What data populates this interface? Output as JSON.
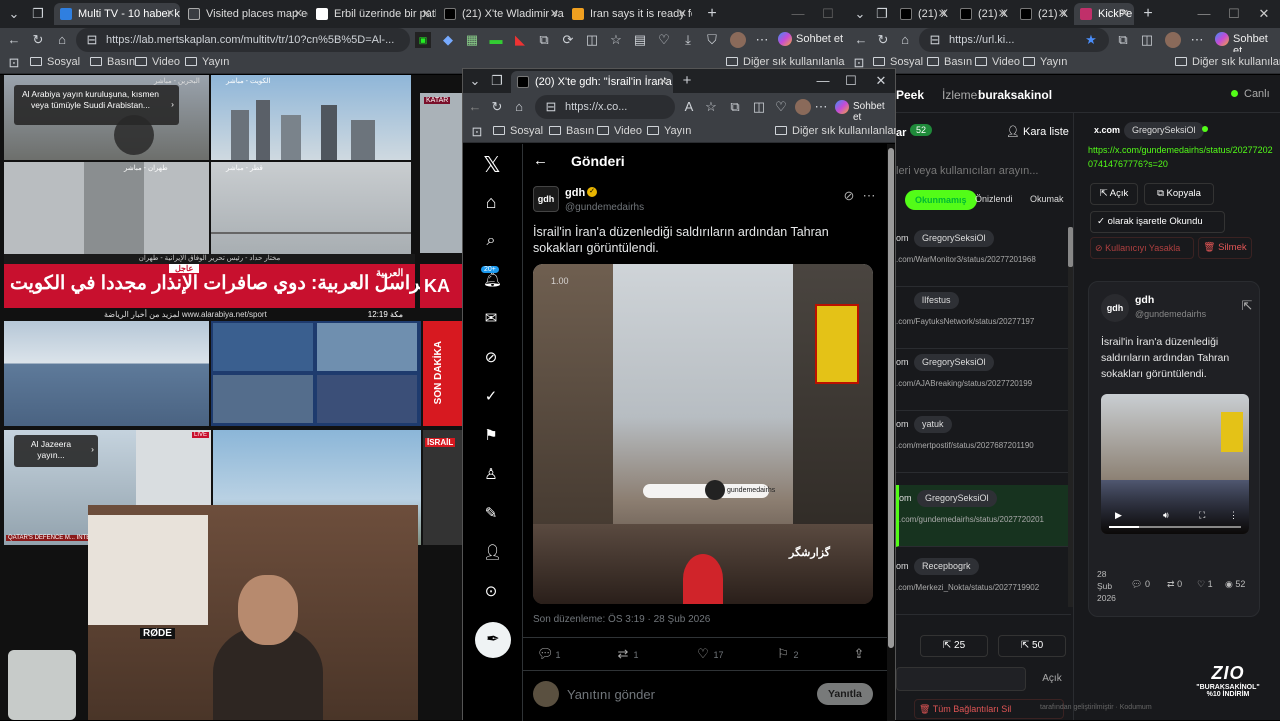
{
  "main_tabs": [
    {
      "label": "Multi TV - 10 haber k",
      "active": true
    },
    {
      "label": "Visited places map editor",
      "active": false
    },
    {
      "label": "Erbil üzerinde bir patlama",
      "active": false
    },
    {
      "label": "(21) X'te Wladimir van W",
      "active": false
    },
    {
      "label": "Iran says it is ready for wa",
      "active": false
    }
  ],
  "right_tabs": [
    {
      "label": "(21) X"
    },
    {
      "label": "(21) X"
    },
    {
      "label": "(21) X"
    },
    {
      "label": "KickPe"
    }
  ],
  "main_address": "https://lab.mertskaplan.com/multitv/tr/10?cn%5B%5D=Al-...",
  "right_address": "https://url.ki...",
  "sohbet_label": "Sohbet et",
  "bookmarks": [
    "Sosyal",
    "Basın",
    "Video",
    "Yayın"
  ],
  "bookmarks_other": "Diğer sık kullanılanlar",
  "tv": {
    "alarabiya_overlay": "Al Arabiya yayın kuruluşuna, kısmen veya tümüyle Suudi Arabistan...",
    "aljazeera_overlay": "Al Jazeera yayın...",
    "alarabiya_urgent": "عاجل",
    "alarabiya_headline": "مراسل العربية: دوي صافرات الإنذار مجددا في الكويت",
    "alarabiya_sub": "لمزيد من أخبار الرياضة www.alarabiya.net/sport",
    "alarabiya_time": "12:19 مكة",
    "alarabiya_logo": "العربية",
    "son_dakika": "SON DAKİKA",
    "israil": "İSRAİL",
    "katar": "KATAR",
    "kuwait_label": "KA",
    "tehran_caption": "مختار حداد - رئيس تحرير الوفاق الإيرانية - طهران",
    "cam_labels": [
      "الكويت - مباشر",
      "البحرين - مباشر",
      "طهران - مباشر",
      "قطر - مباشر"
    ],
    "qatar_defence": "QATAR'S DEFENCE M... INTERCEPTED A N...",
    "live_badge": "LIVE",
    "rode_label": "RØDE"
  },
  "popup": {
    "tab_title": "(20) X'te gdh: \"İsrail'in İran'a d",
    "address": "https://x.co...",
    "sohbet": "Sohbet et",
    "bookmarks": [
      "Sosyal",
      "Basın",
      "Video",
      "Yayın"
    ],
    "bookmarks_other": "Diğer sık kullanılanlar",
    "x_logo": "𝕏",
    "notif_count": "20+",
    "header_title": "Gönderi",
    "author_name": "gdh",
    "author_handle": "@gundemedairhs",
    "avatar_text": "gdh",
    "post_text": "İsrail'in İran'a düzenlediği saldırıların ardından Tahran sokakları görüntülendi.",
    "video_timecode": "1.00",
    "video_watermark": "gundemedairhs",
    "video_overlay_text": "گزارشگر",
    "edited_line": "Son düzenleme: ÖS 3:19 · 28 Şub 2026",
    "replies": "1",
    "reposts": "1",
    "likes": "17",
    "bookmarks_count": "2",
    "reply_placeholder": "Yanıtını gönder",
    "reply_button": "Yanıtla"
  },
  "kick": {
    "brand": "Peek",
    "watching_label": "İzleme:",
    "watching_user": "buraksakinol",
    "live_label": "Canlı",
    "list_tab": "ar",
    "count_badge": "52",
    "blacklist": "Kara liste",
    "search_placeholder": "leri veya kullanıcıları arayın...",
    "filters": [
      "Okunmamış",
      "Önizlendi",
      "Okumak"
    ],
    "rows": [
      {
        "prefix": "om",
        "user": "GregorySeksiOl",
        "link": ".com/WarMonitor3/status/20277201968"
      },
      {
        "prefix": "",
        "user": "lIfestus",
        "link": ".com/FaytuksNetwork/status/20277197"
      },
      {
        "prefix": "om",
        "user": "GregorySeksiOl",
        "link": ".com/AJABreaking/status/2027720199"
      },
      {
        "prefix": "om",
        "user": "yatuk",
        "link": ".com/mertpostif/status/2027687201190"
      },
      {
        "prefix": "om",
        "user": "GregorySeksiOl",
        "link": ".com/gundemedairhs/status/2027720201"
      },
      {
        "prefix": "om",
        "user": "Recepbogrk",
        "link": ".com/Merkezi_Nokta/status/2027719902"
      }
    ],
    "btn_25": "25",
    "btn_50": "50",
    "open_btn": "Açık",
    "delete_all": "Tüm Bağlantıları Sil",
    "source_site": "x.com",
    "source_user": "GregorySeksiOl",
    "detail_link": "https://x.com/gundemedairhs/status/2027720207414767776?s=20",
    "action_open": "Açık",
    "action_copy": "Kopyala",
    "mark_read": "olarak işaretle Okundu",
    "ban_user": "Kullanıcıyı Yasakla",
    "delete": "Silmek",
    "card_name": "gdh",
    "card_handle": "@gundemedairhs",
    "card_avatar": "gdh",
    "card_text": "İsrail'in İran'a düzenlediği saldırıların ardından Tahran sokakları görüntülendi.",
    "card_date_day": "28",
    "card_date_month": "Şub",
    "card_date_year": "2026",
    "card_replies": "0",
    "card_reposts": "0",
    "card_likes": "1",
    "card_views": "52",
    "footer": "tarafından geliştirilmiştir · Kodumum"
  },
  "promo": {
    "logo": "ZIO",
    "line1": "\"BURAKSAKİNOL\"",
    "line2": "%10 İNDİRİM"
  }
}
